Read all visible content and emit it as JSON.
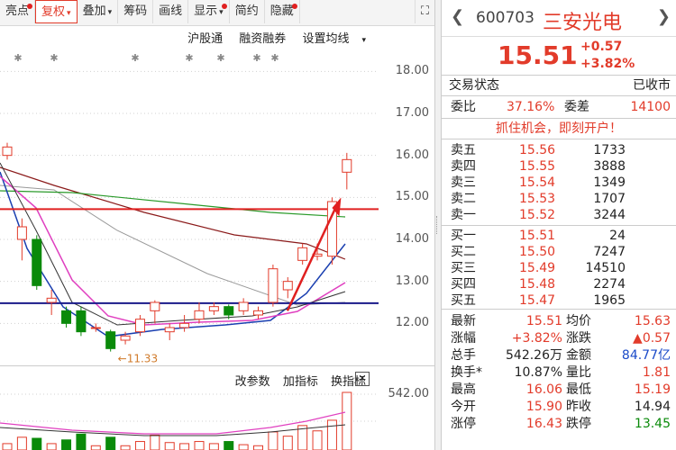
{
  "toolbar": {
    "items": [
      {
        "label": "亮点",
        "dot": true
      },
      {
        "label": "复权",
        "caret": "▾",
        "active": true
      },
      {
        "label": "叠加",
        "caret": "▾"
      },
      {
        "label": "筹码"
      },
      {
        "label": "画线"
      },
      {
        "label": "显示",
        "caret": "▾",
        "dot": true
      },
      {
        "label": "简约"
      },
      {
        "label": "隐藏",
        "dot": true
      }
    ],
    "expand_icon": "⛶"
  },
  "subtoolbar": {
    "hgt": "沪股通",
    "rzrq": "融资融券",
    "ma": "设置均线"
  },
  "price_axis": [
    "18.00",
    "17.00",
    "16.00",
    "15.00",
    "14.00",
    "13.00",
    "12.00"
  ],
  "low_marker": "←11.33",
  "indicator_bar": {
    "params": "改参数",
    "add": "加指标",
    "switch": "换指标",
    "close": "✕"
  },
  "volume_label": "542.00",
  "colors": {
    "up": "#e23b2a",
    "down": "#0a8a0a",
    "ma5": "#333333",
    "ma10": "#e040c0",
    "ma20": "#1a3fb0",
    "ma60": "#8b1a1a",
    "ma120": "#2a9a2a",
    "ma250": "#999999",
    "support": "#1a1a8a",
    "resistance": "#e02020"
  },
  "quote": {
    "code": "600703",
    "name": "三安光电",
    "price": "15.51",
    "change": "+0.57",
    "change_pct": "+3.82%",
    "status_label": "交易状态",
    "status_value": "已收市",
    "wb_label": "委比",
    "wb_value": "37.16%",
    "wc_label": "委差",
    "wc_value": "14100",
    "ad_text": "抓住机会，即刻开户！",
    "asks": [
      {
        "label": "卖五",
        "price": "15.56",
        "vol": "1733"
      },
      {
        "label": "卖四",
        "price": "15.55",
        "vol": "3888"
      },
      {
        "label": "卖三",
        "price": "15.54",
        "vol": "1349"
      },
      {
        "label": "卖二",
        "price": "15.53",
        "vol": "1707"
      },
      {
        "label": "卖一",
        "price": "15.52",
        "vol": "3244"
      }
    ],
    "bids": [
      {
        "label": "买一",
        "price": "15.51",
        "vol": "24"
      },
      {
        "label": "买二",
        "price": "15.50",
        "vol": "7247"
      },
      {
        "label": "买三",
        "price": "15.49",
        "vol": "14510"
      },
      {
        "label": "买四",
        "price": "15.48",
        "vol": "2274"
      },
      {
        "label": "买五",
        "price": "15.47",
        "vol": "1965"
      }
    ],
    "stats": [
      {
        "l1": "最新",
        "v1": "15.51",
        "c1": "red",
        "l2": "均价",
        "v2": "15.63",
        "c2": "red"
      },
      {
        "l1": "涨幅",
        "v1": "+3.82%",
        "c1": "red",
        "l2": "涨跌",
        "v2": "▲0.57",
        "c2": "red"
      },
      {
        "l1": "总手",
        "v1": "542.26万",
        "c1": "black",
        "l2": "金额",
        "v2": "84.77亿",
        "c2": "blue"
      },
      {
        "l1": "换手*",
        "v1": "10.87%",
        "c1": "black",
        "l2": "量比",
        "v2": "1.81",
        "c2": "red"
      },
      {
        "l1": "最高",
        "v1": "16.06",
        "c1": "red",
        "l2": "最低",
        "v2": "15.19",
        "c2": "red"
      },
      {
        "l1": "今开",
        "v1": "15.90",
        "c1": "red",
        "l2": "昨收",
        "v2": "14.94",
        "c2": "black"
      },
      {
        "l1": "涨停",
        "v1": "16.43",
        "c1": "red",
        "l2": "跌停",
        "v2": "13.45",
        "c2": "green"
      }
    ]
  },
  "chart_data": {
    "type": "candlestick",
    "y_range": [
      11.0,
      18.5
    ],
    "candles": [
      {
        "o": 16.0,
        "c": 16.2,
        "h": 16.3,
        "l": 15.9
      },
      {
        "o": 14.0,
        "c": 14.3,
        "h": 14.5,
        "l": 13.5
      },
      {
        "o": 14.0,
        "c": 12.9,
        "h": 14.1,
        "l": 12.8
      },
      {
        "o": 12.5,
        "c": 12.6,
        "h": 12.8,
        "l": 12.2
      },
      {
        "o": 12.3,
        "c": 12.0,
        "h": 12.4,
        "l": 11.9
      },
      {
        "o": 12.3,
        "c": 11.8,
        "h": 12.4,
        "l": 11.7
      },
      {
        "o": 11.9,
        "c": 11.9,
        "h": 12.0,
        "l": 11.8
      },
      {
        "o": 11.8,
        "c": 11.4,
        "h": 11.85,
        "l": 11.33
      },
      {
        "o": 11.6,
        "c": 11.7,
        "h": 11.8,
        "l": 11.5
      },
      {
        "o": 11.8,
        "c": 12.1,
        "h": 12.2,
        "l": 11.7
      },
      {
        "o": 12.3,
        "c": 12.5,
        "h": 12.55,
        "l": 12.0
      },
      {
        "o": 11.8,
        "c": 11.9,
        "h": 12.0,
        "l": 11.6
      },
      {
        "o": 11.9,
        "c": 12.0,
        "h": 12.2,
        "l": 11.8
      },
      {
        "o": 12.1,
        "c": 12.3,
        "h": 12.5,
        "l": 12.0
      },
      {
        "o": 12.3,
        "c": 12.4,
        "h": 12.5,
        "l": 12.2
      },
      {
        "o": 12.4,
        "c": 12.2,
        "h": 12.45,
        "l": 12.1
      },
      {
        "o": 12.3,
        "c": 12.5,
        "h": 12.6,
        "l": 12.2
      },
      {
        "o": 12.2,
        "c": 12.3,
        "h": 12.4,
        "l": 12.1
      },
      {
        "o": 12.5,
        "c": 13.3,
        "h": 13.4,
        "l": 12.4
      },
      {
        "o": 12.8,
        "c": 13.0,
        "h": 13.1,
        "l": 12.6
      },
      {
        "o": 13.5,
        "c": 13.8,
        "h": 13.9,
        "l": 13.4
      },
      {
        "o": 13.6,
        "c": 13.65,
        "h": 13.9,
        "l": 13.5
      },
      {
        "o": 13.6,
        "c": 14.9,
        "h": 15.0,
        "l": 13.4
      },
      {
        "o": 15.6,
        "c": 15.9,
        "h": 16.06,
        "l": 15.19
      }
    ],
    "volume_max": 542.0,
    "volume": [
      60,
      120,
      110,
      60,
      95,
      150,
      40,
      120,
      40,
      80,
      140,
      70,
      60,
      80,
      60,
      80,
      50,
      40,
      170,
      130,
      230,
      180,
      280,
      542
    ]
  }
}
